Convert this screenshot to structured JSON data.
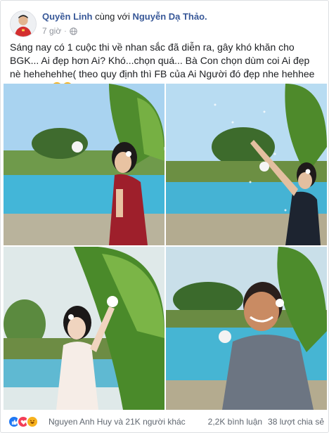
{
  "post": {
    "author": "Quyền Linh",
    "with_text": "cùng với",
    "tagged": "Nguyễn Dạ Thảo.",
    "time": "7 giờ",
    "separator": "·",
    "privacy_icon": "globe-icon",
    "text": "Sáng nay có 1 cuộc thi về nhan sắc đã diễn ra, gây khó khăn cho BGK... Ai đẹp hơn Ai? Khó...chọn quá... Bà Con chọn dùm coi Ai đẹp nè hehehehhe( theo quy định thì FB của Ai Người đó đẹp nhe hehhee zezezeze",
    "text_end": ")",
    "emojis": [
      "heart-eyes-emoji",
      "heart-eyes-emoji"
    ]
  },
  "photos": [
    {
      "name": "photo-girl-red-dress-pool"
    },
    {
      "name": "photo-girl-black-dress-flowers"
    },
    {
      "name": "photo-woman-white-dress-tree"
    },
    {
      "name": "photo-man-flower-ear-pool"
    }
  ],
  "footer": {
    "reaction_icons": [
      "like-icon",
      "love-icon",
      "haha-icon"
    ],
    "reaction_text": "Nguyen Anh Huy và 21K người khác",
    "comments": "2,2K bình luận",
    "shares": "38 lượt chia sẻ"
  },
  "colors": {
    "author_link": "#385898",
    "meta_gray": "#90949c",
    "like_blue": "#2078f4",
    "love_red": "#f33e58",
    "haha_yellow": "#f7b21d"
  }
}
